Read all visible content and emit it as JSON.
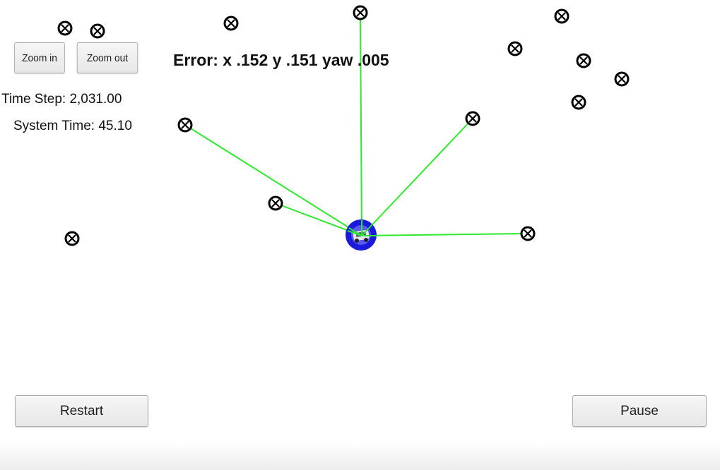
{
  "controls": {
    "zoom_in_label": "Zoom in",
    "zoom_out_label": "Zoom out",
    "restart_label": "Restart",
    "pause_label": "Pause"
  },
  "status": {
    "time_step": "Time Step: 2,031.00",
    "system_time": "System Time: 45.10",
    "error": "Error: x .152 y .151 yaw .005"
  },
  "colors": {
    "sensor_line": "#2ee82e",
    "vehicle": "#1a1adb",
    "landmark": "#000000"
  },
  "icons": {
    "landmark": "landmark-marker-icon",
    "vehicle": "vehicle-icon"
  }
}
